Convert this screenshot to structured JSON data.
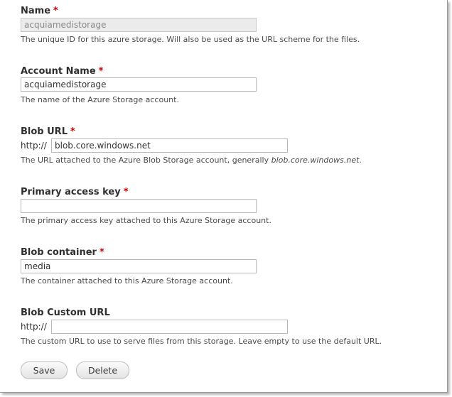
{
  "required_marker": "*",
  "fields": {
    "name": {
      "label": "Name",
      "value": "acquiamedistorage",
      "description": "The unique ID for this azure storage. Will also be used as the URL scheme for the files."
    },
    "account_name": {
      "label": "Account Name",
      "value": "acquiamedistorage",
      "description": "The name of the Azure Storage account."
    },
    "blob_url": {
      "label": "Blob URL",
      "prefix": "http://",
      "value": "blob.core.windows.net",
      "description_text": "The URL attached to the Azure Blob Storage account, generally ",
      "description_em": "blob.core.windows.net",
      "description_end": "."
    },
    "primary_access_key": {
      "label": "Primary access key",
      "value": "",
      "description": "The primary access key attached to this Azure Storage account."
    },
    "blob_container": {
      "label": "Blob container",
      "value": "media",
      "description": "The container attached to this Azure Storage account."
    },
    "blob_custom_url": {
      "label": "Blob Custom URL",
      "prefix": "http://",
      "value": "",
      "description": "The custom URL to use to serve files from this storage. Leave empty to use the default URL."
    }
  },
  "actions": {
    "save_label": "Save",
    "delete_label": "Delete"
  },
  "colors": {
    "required": "#cc0000",
    "disabled_bg": "#ebebeb"
  }
}
